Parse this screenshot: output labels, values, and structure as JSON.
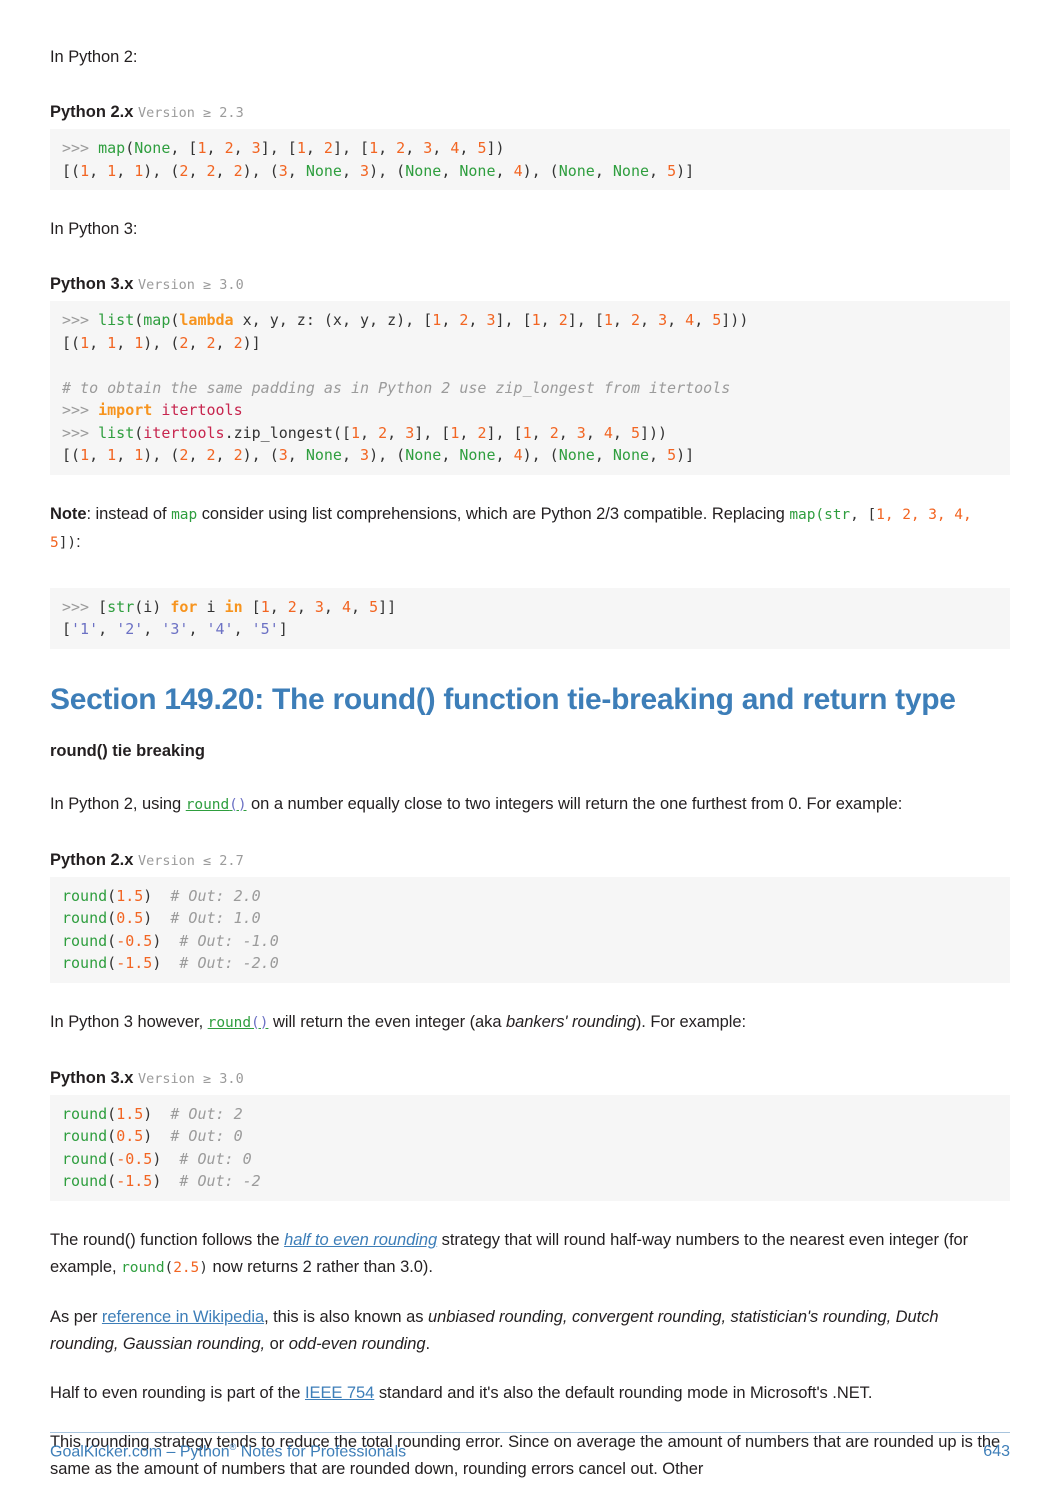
{
  "document": {
    "footer": {
      "left_prefix": "GoalKicker.com – Python",
      "left_reg": "®",
      "left_suffix": " Notes for Professionals",
      "page_number": "643"
    },
    "colors": {
      "heading_blue": "#3d7eb8",
      "link_blue": "#3d7eb8",
      "link_green": "#2e9e3e",
      "code_bg": "#f6f6f6",
      "number_orange": "#f26522",
      "keyword_orange": "#f7941e",
      "function_green": "#2e9e3e",
      "comment_gray": "#9b9b9b",
      "string_purple": "#6c71c4",
      "module_crimson": "#c7254e",
      "body_text": "#231f20"
    }
  },
  "intro": {
    "py2_label": "In Python 2:",
    "py3_label": "In Python 3:"
  },
  "version_labels": {
    "py2_map": {
      "name": "Python 2.x",
      "version": "Version ≥ 2.3"
    },
    "py3_map": {
      "name": "Python 3.x",
      "version": "Version ≥ 3.0"
    },
    "py2_round": {
      "name": "Python 2.x",
      "version": "Version ≤ 2.7"
    },
    "py3_round": {
      "name": "Python 3.x",
      "version": "Version ≥ 3.0"
    }
  },
  "code_blocks": {
    "map_py2": {
      "line1": {
        "prompt": ">>> ",
        "fn": "map",
        "open": "(",
        "none": "None",
        "mid1": ", [",
        "n1": "1",
        "c1": ", ",
        "n2": "2",
        "c2": ", ",
        "n3": "3",
        "mid2": "], [",
        "n4": "1",
        "c3": ", ",
        "n5": "2",
        "mid3": "], [",
        "n6": "1",
        "c4": ", ",
        "n7": "2",
        "c5": ", ",
        "n8": "3",
        "c6": ", ",
        "n9": "4",
        "c7": ", ",
        "n10": "5",
        "tail": "])"
      },
      "line2_text": "[(1, 1, 1), (2, 2, 2), (3, None, 3), (None, None, 4), (None, None, 5)]"
    },
    "map_py3": {
      "line1_text": ">>> list(map(lambda x, y, z: (x, y, z), [1, 2, 3], [1, 2], [1, 2, 3, 4, 5]))",
      "line2_text": "[(1, 1, 1), (2, 2, 2)]"
    },
    "zip_longest": {
      "comment": "# to obtain the same padding as in Python 2 use zip_longest from itertools",
      "import_line": ">>> import itertools",
      "call_line": ">>> list(itertools.zip_longest([1, 2, 3], [1, 2], [1, 2, 3, 4, 5]))",
      "out_line": "[(1, 1, 1), (2, 2, 2), (3, None, 3), (None, None, 4), (None, None, 5)]"
    },
    "listcomp": {
      "line1_text": ">>> [str(i) for i in [1, 2, 3, 4, 5]]",
      "line2_text": "['1', '2', '3', '4', '5']"
    },
    "round_py2": {
      "rows": [
        {
          "call": "round",
          "arg": "1.5",
          "comment": "# Out: 2.0"
        },
        {
          "call": "round",
          "arg": "0.5",
          "comment": "# Out: 1.0"
        },
        {
          "call": "round",
          "arg": "-0.5",
          "comment": "# Out: -1.0"
        },
        {
          "call": "round",
          "arg": "-1.5",
          "comment": "# Out: -2.0"
        }
      ]
    },
    "round_py3": {
      "rows": [
        {
          "call": "round",
          "arg": "1.5",
          "comment": "# Out: 2"
        },
        {
          "call": "round",
          "arg": "0.5",
          "comment": "# Out: 0"
        },
        {
          "call": "round",
          "arg": "-0.5",
          "comment": "# Out: 0"
        },
        {
          "call": "round",
          "arg": "-1.5",
          "comment": "# Out: -2"
        }
      ]
    }
  },
  "note_paragraph": {
    "bold_label": "Note",
    "t1": ": instead of ",
    "code_map": "map",
    "t2": " consider using list comprehensions, which are Python 2/3 compatible. Replacing ",
    "code_map2": "map(",
    "code_str": "str",
    "code_rest": ", [",
    "code_nums": "1, 2, 3, 4, 5",
    "code_close": "])",
    "t3": ":"
  },
  "section": {
    "title": "Section 149.20: The round() function tie-breaking and return type",
    "subheading": "round() tie breaking"
  },
  "round_para_py2": {
    "t1": "In Python 2, using ",
    "link": "round",
    "link_parens": "()",
    "t2": " on a number equally close to two integers will return the one furthest from 0. For example:"
  },
  "round_para_py3": {
    "t1": "In Python 3 however, ",
    "link": "round",
    "link_parens": "()",
    "t2": " will return the even integer (aka ",
    "italic": "bankers' rounding",
    "t3": "). For example:"
  },
  "half_even_para": {
    "t1": "The round() function follows the ",
    "link": "half to even rounding",
    "t2": " strategy that will round half-way numbers to the nearest even integer (for example, ",
    "code_round": "round",
    "code_open": "(",
    "code_num": "2.5",
    "code_close": ")",
    "t3": " now returns 2 rather than 3.0)."
  },
  "wikipedia_para": {
    "t1": "As per ",
    "link": "reference in Wikipedia",
    "t2": ", this is also known as ",
    "italic": "unbiased rounding, convergent rounding, statistician's rounding, Dutch rounding, Gaussian rounding,",
    "t3": " or ",
    "italic2": "odd-even rounding",
    "t4": "."
  },
  "ieee_para": {
    "t1": "Half to even rounding is part of the ",
    "link": "IEEE 754",
    "t2": " standard and it's also the default rounding mode in Microsoft's .NET."
  },
  "final_para": {
    "text": "This rounding strategy tends to reduce the total rounding error. Since on average the amount of numbers that are rounded up is the same as the amount of numbers that are rounded down, rounding errors cancel out. Other"
  }
}
